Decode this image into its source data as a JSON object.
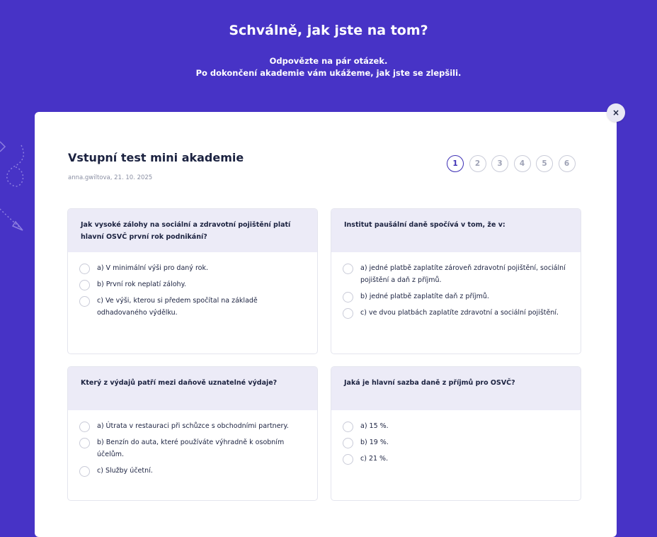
{
  "hero": {
    "title": "Schválně, jak jste na tom?",
    "subtitle_line1": "Odpovězte na pár otázek.",
    "subtitle_line2": "Po dokončení akademie vám ukážeme, jak jste se zlepšili."
  },
  "modal": {
    "close_label": "×",
    "title": "Vstupní test mini akademie",
    "meta": "anna.gwiltova, 21. 10. 2025",
    "steps": [
      "1",
      "2",
      "3",
      "4",
      "5",
      "6"
    ],
    "active_step": 1
  },
  "questions": [
    {
      "text": "Jak vysoké zálohy na sociální a zdravotní pojištění platí hlavní OSVČ první rok podnikání?",
      "options": [
        "a) V minimální výši pro daný rok.",
        "b) První rok neplatí zálohy.",
        "c) Ve výši, kterou si předem spočítal na základě odhadovaného výdělku."
      ]
    },
    {
      "text": "Institut paušální daně spočívá v tom, že v:",
      "options": [
        "a) jedné platbě zaplatíte zároveň zdravotní pojištění, sociální pojištění a daň z příjmů.",
        "b) jedné platbě zaplatíte daň z příjmů.",
        "c) ve dvou platbách zaplatíte zdravotní a sociální pojištění."
      ]
    },
    {
      "text": "Který z výdajů patří mezi daňově uznatelné výdaje?",
      "options": [
        "a) Útrata v restauraci při schůzce s obchodními partnery.",
        "b) Benzín do auta, které používáte výhradně k osobním účelům.",
        "c) Služby účetní."
      ]
    },
    {
      "text": "Jaká je hlavní sazba daně z příjmů pro OSVČ?",
      "options": [
        "a) 15 %.",
        "b) 19 %.",
        "c) 21 %."
      ]
    }
  ],
  "colors": {
    "background": "#4733c6",
    "accent": "#3d2fb5",
    "question_header": "#ecebf7"
  }
}
